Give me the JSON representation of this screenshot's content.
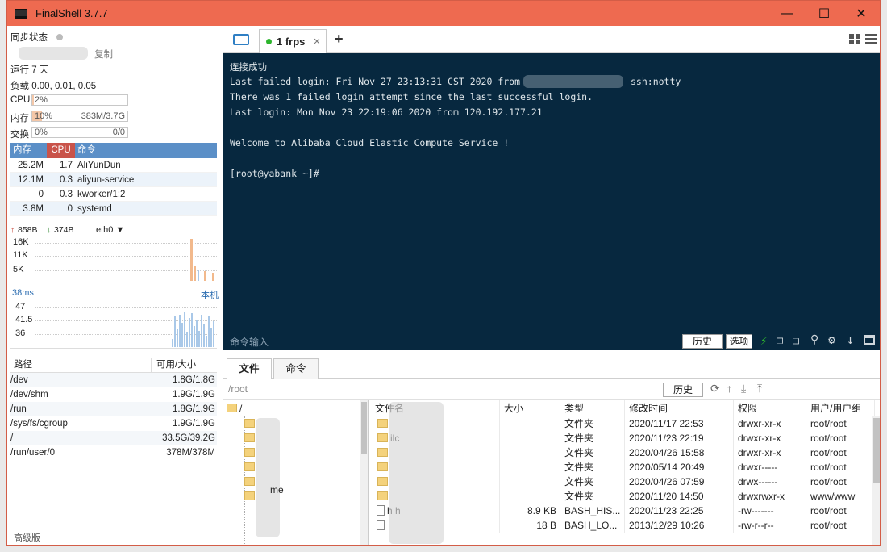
{
  "app": {
    "title": "FinalShell 3.7.7"
  },
  "window_controls": {
    "minimize": "—",
    "maximize": "☐",
    "close": "✕"
  },
  "left": {
    "sync_status": "同步状态",
    "copy": "复制",
    "uptime": "运行 7 天",
    "load": "负载 0.00, 0.01, 0.05",
    "cpu": {
      "label": "CPU",
      "value": "2%",
      "fraction": 0.02
    },
    "mem": {
      "label": "内存",
      "value": "10%",
      "detail": "383M/3.7G",
      "fraction": 0.1
    },
    "swap": {
      "label": "交换",
      "value": "0%",
      "detail": "0/0"
    },
    "proc_headers": [
      "内存",
      "CPU",
      "命令"
    ],
    "processes": [
      {
        "mem": "25.2M",
        "cpu": "1.7",
        "cmd": "AliYunDun"
      },
      {
        "mem": "12.1M",
        "cpu": "0.3",
        "cmd": "aliyun-service"
      },
      {
        "mem": "0",
        "cpu": "0.3",
        "cmd": "kworker/1:2"
      },
      {
        "mem": "3.8M",
        "cpu": "0",
        "cmd": "systemd"
      }
    ],
    "net": {
      "up": "858B",
      "down": "374B",
      "iface": "eth0",
      "ticks": [
        "16K",
        "11K",
        "5K"
      ]
    },
    "ping": {
      "latency": "38ms",
      "host": "本机",
      "ticks": [
        "47",
        "41.5",
        "36"
      ]
    },
    "disk_headers": [
      "路径",
      "可用/大小"
    ],
    "disks": [
      {
        "path": "/dev",
        "size": "1.8G/1.8G"
      },
      {
        "path": "/dev/shm",
        "size": "1.9G/1.9G"
      },
      {
        "path": "/run",
        "size": "1.8G/1.9G"
      },
      {
        "path": "/sys/fs/cgroup",
        "size": "1.9G/1.9G"
      },
      {
        "path": "/",
        "size": "33.5G/39.2G"
      },
      {
        "path": "/run/user/0",
        "size": "378M/378M"
      }
    ],
    "advanced": "高级版"
  },
  "tabs": {
    "session_label": "1 frps",
    "add": "+"
  },
  "terminal": {
    "lines": [
      "连接成功",
      "Last failed login: Fri Nov 27 23:13:31 CST 2020 from",
      "ssh:notty",
      "There was 1 failed login attempt since the last successful login.",
      "Last login: Mon Nov 23 22:19:06 2020 from 120.192.177.21",
      "Welcome to Alibaba Cloud Elastic Compute Service !",
      "[root@yabank ~]#"
    ],
    "cmd_placeholder": "命令输入",
    "history": "历史",
    "options": "选项"
  },
  "files": {
    "tab_files": "文件",
    "tab_commands": "命令",
    "path": "/root",
    "history": "历史",
    "tree_root": "/",
    "tree_visible": "me",
    "headers": [
      "文件名",
      "大小",
      "类型",
      "修改时间",
      "权限",
      "用户/用户组"
    ],
    "rows": [
      {
        "name": "",
        "size": "",
        "type": "文件夹",
        "time": "2020/11/17 22:53",
        "perm": "drwxr-xr-x",
        "owner": "root/root",
        "kind": "folder"
      },
      {
        "name": "ilc",
        "size": "",
        "type": "文件夹",
        "time": "2020/11/23 22:19",
        "perm": "drwxr-xr-x",
        "owner": "root/root",
        "kind": "folder"
      },
      {
        "name": "",
        "size": "",
        "type": "文件夹",
        "time": "2020/04/26 15:58",
        "perm": "drwxr-xr-x",
        "owner": "root/root",
        "kind": "folder"
      },
      {
        "name": "",
        "size": "",
        "type": "文件夹",
        "time": "2020/05/14 20:49",
        "perm": "drwxr-----",
        "owner": "root/root",
        "kind": "folder"
      },
      {
        "name": "",
        "size": "",
        "type": "文件夹",
        "time": "2020/04/26 07:59",
        "perm": "drwx------",
        "owner": "root/root",
        "kind": "folder"
      },
      {
        "name": "",
        "size": "",
        "type": "文件夹",
        "time": "2020/11/20 14:50",
        "perm": "drwxrwxr-x",
        "owner": "www/www",
        "kind": "folder"
      },
      {
        "name": "h h",
        "size": "8.9 KB",
        "type": "BASH_HIS...",
        "time": "2020/11/23 22:25",
        "perm": "-rw-------",
        "owner": "root/root",
        "kind": "file"
      },
      {
        "name": "",
        "size": "18 B",
        "type": "BASH_LO...",
        "time": "2013/12/29 10:26",
        "perm": "-rw-r--r--",
        "owner": "root/root",
        "kind": "file"
      }
    ]
  },
  "colors": {
    "titlebar": "#ee6a50",
    "terminal_bg": "#07283f",
    "accent_blue": "#5b8fc7",
    "cpu_red": "#c9534a",
    "status_green": "#2db52d"
  }
}
